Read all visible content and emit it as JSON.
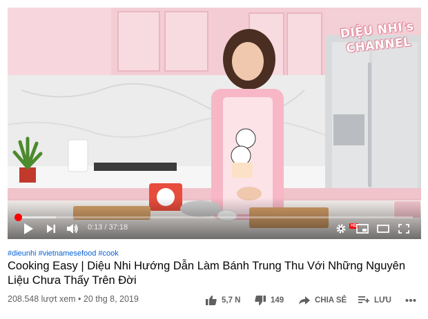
{
  "player": {
    "watermark_line1": "DIỆU NHI's",
    "watermark_line2": "CHANNEL",
    "time_current": "0:13",
    "time_total": "37:18",
    "time_separator": " / ",
    "progress_fraction": 0.006,
    "hd_badge": "HD",
    "accent_color": "#ff0000"
  },
  "video": {
    "hashtags": [
      "#dieunhi",
      "#vietnamesefood",
      "#cook"
    ],
    "title": "Cooking Easy | Diệu Nhi Hướng Dẫn Làm Bánh Trung Thu Với Những Nguyên Liệu Chưa Thấy Trên Đời",
    "views": "208.548 lượt xem",
    "separator": " • ",
    "date": "20 thg 8, 2019"
  },
  "actions": {
    "like_count": "5,7 N",
    "dislike_count": "149",
    "share_label": "CHIA SẺ",
    "save_label": "LƯU"
  },
  "icons": {
    "play": "play-icon",
    "next": "next-icon",
    "volume": "volume-icon",
    "settings": "gear-icon",
    "miniplayer": "miniplayer-icon",
    "theater": "theater-icon",
    "fullscreen": "fullscreen-icon",
    "like": "thumbs-up-icon",
    "dislike": "thumbs-down-icon",
    "share": "share-icon",
    "save": "playlist-add-icon",
    "more": "more-icon"
  }
}
